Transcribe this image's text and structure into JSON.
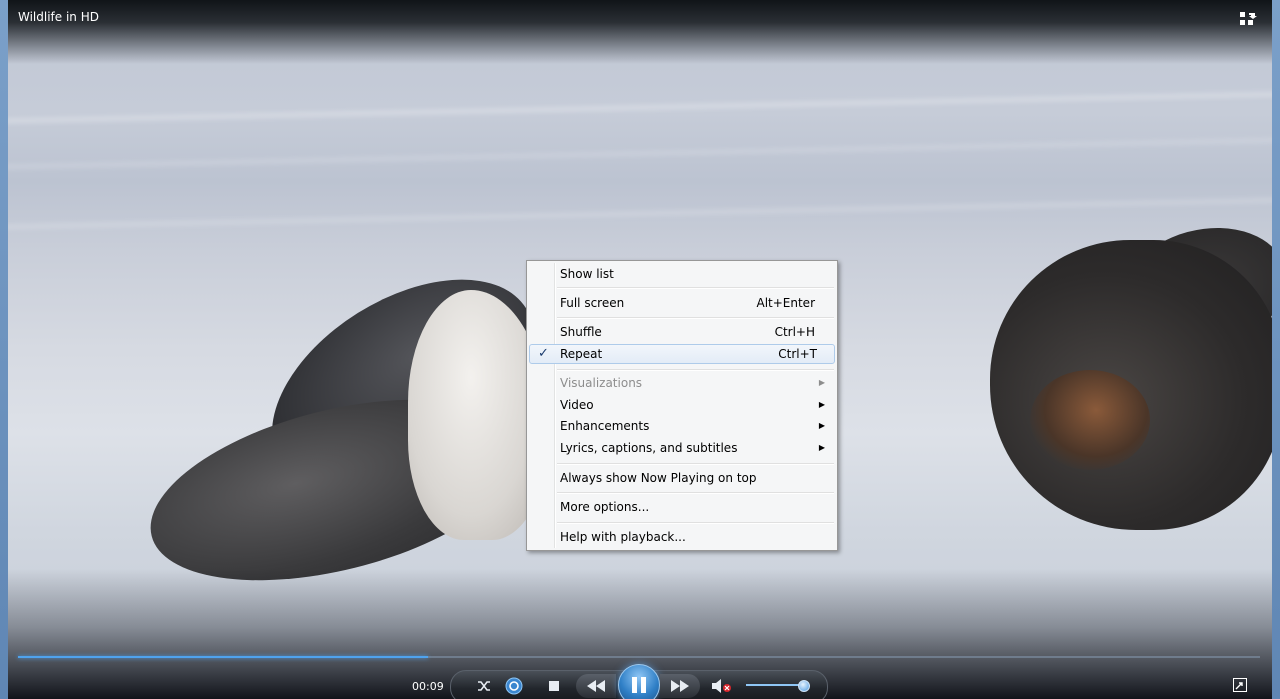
{
  "window": {
    "title": "Wildlife in HD"
  },
  "playback": {
    "time": "00:09",
    "progress_fraction": 0.33,
    "volume_fraction": 0.85
  },
  "context_menu": {
    "items": [
      {
        "label": "Show list",
        "accel": ""
      },
      {
        "label": "Full screen",
        "accel": "Alt+Enter"
      },
      {
        "label": "Shuffle",
        "accel": "Ctrl+H"
      },
      {
        "label": "Repeat",
        "accel": "Ctrl+T",
        "checked": true
      },
      {
        "label": "Visualizations",
        "disabled": true,
        "submenu": true
      },
      {
        "label": "Video",
        "submenu": true
      },
      {
        "label": "Enhancements",
        "submenu": true
      },
      {
        "label": "Lyrics, captions, and subtitles",
        "submenu": true
      },
      {
        "label": "Always show Now Playing on top"
      },
      {
        "label": "More options..."
      },
      {
        "label": "Help with playback..."
      }
    ],
    "check_glyph": "✓",
    "submenu_glyph": "▶"
  },
  "icons": {
    "switch_to_library": "switch-to-library-icon",
    "shuffle": "shuffle-icon",
    "repeat": "repeat-icon",
    "stop": "stop-icon",
    "previous": "previous-icon",
    "pause": "pause-icon",
    "next": "next-icon",
    "mute": "mute-icon",
    "fullscreen": "fullscreen-icon"
  },
  "colors": {
    "accent": "#4fa3ee",
    "menu_bg": "#f5f6f7"
  }
}
